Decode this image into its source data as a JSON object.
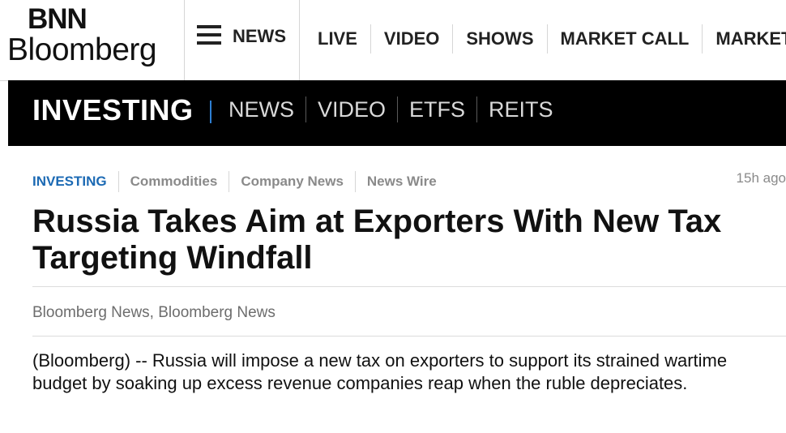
{
  "brand": {
    "logo_top": "BNN",
    "logo_bottom": "Bloomberg"
  },
  "top_nav": {
    "menu_label": "NEWS",
    "items": [
      "LIVE",
      "VIDEO",
      "SHOWS",
      "MARKET CALL",
      "MARKETS"
    ]
  },
  "section": {
    "title": "INVESTING",
    "items": [
      "NEWS",
      "VIDEO",
      "ETFS",
      "REITS"
    ]
  },
  "article": {
    "tags": [
      "INVESTING",
      "Commodities",
      "Company News",
      "News Wire"
    ],
    "timestamp": "15h ago",
    "headline": "Russia Takes Aim at Exporters With New Tax Targeting Windfall",
    "byline": "Bloomberg News, Bloomberg News",
    "body": "(Bloomberg) -- Russia will impose a new tax on exporters to support its strained wartime budget by soaking up excess revenue companies reap when the ruble depreciates."
  },
  "colors": {
    "accent_blue": "#1c6ab4",
    "section_bar": "#000000",
    "separator_blue": "#2d7fd3"
  },
  "icons": {
    "menu": "hamburger-menu-icon"
  }
}
